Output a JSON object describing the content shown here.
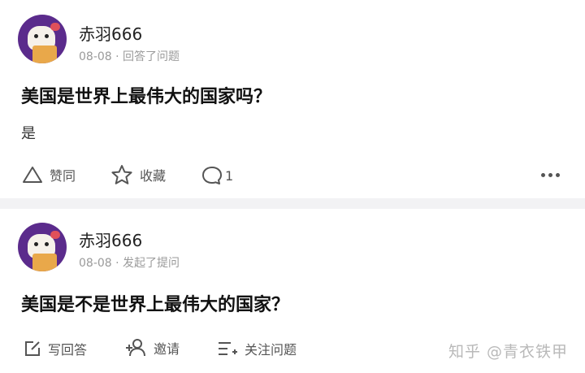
{
  "posts": [
    {
      "user": "赤羽666",
      "meta": "08-08 · 回答了问题",
      "title": "美国是世界上最伟大的国家吗？",
      "answer": "是",
      "actions": {
        "upvote": "赞同",
        "favorite": "收藏",
        "comment_count": "1"
      }
    },
    {
      "user": "赤羽666",
      "meta": "08-08 · 发起了提问",
      "title": "美国是不是世界上最伟大的国家？",
      "actions": {
        "write_answer": "写回答",
        "invite": "邀请",
        "follow_question": "关注问题"
      }
    }
  ],
  "watermark": "知乎 @青衣铁甲"
}
